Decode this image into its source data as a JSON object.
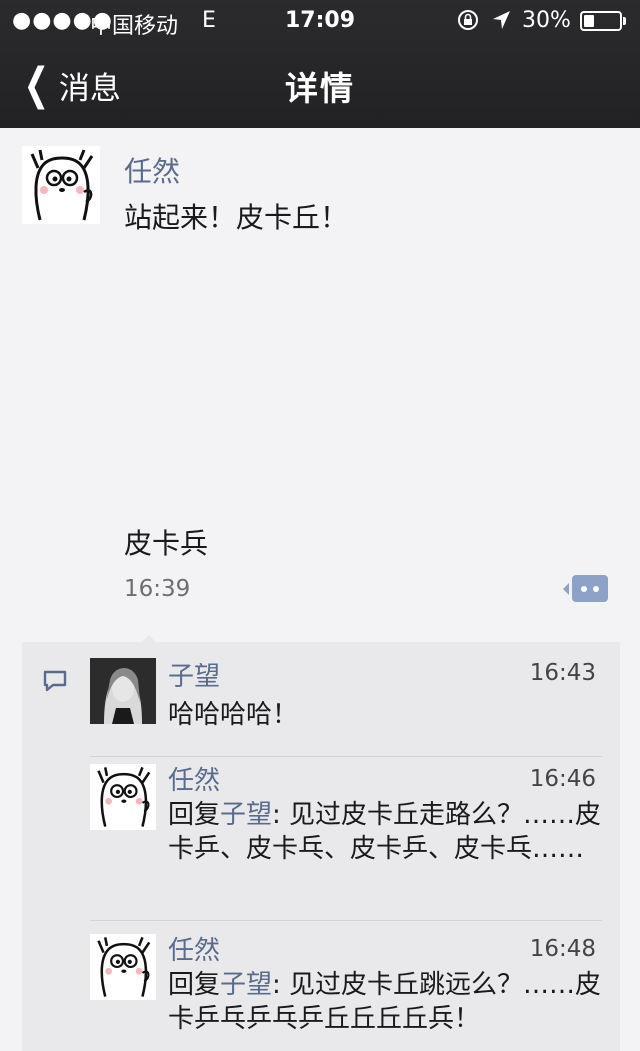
{
  "status_bar": {
    "signal": "●●●●●",
    "carrier": "中国移动",
    "network": "E",
    "time": "17:09",
    "battery_text": "30%",
    "battery_level": 0.3
  },
  "nav": {
    "back_label": "消息",
    "title": "详情"
  },
  "post": {
    "author": "任然",
    "text_line1": "站起来！皮卡丘！",
    "text_line2": "皮卡兵",
    "time": "16:39"
  },
  "comments": [
    {
      "author": "子望",
      "time": "16:43",
      "text": "哈哈哈哈！"
    },
    {
      "author": "任然",
      "time": "16:46",
      "reply_prefix": "回复",
      "reply_to": "子望",
      "text": ": 见过皮卡丘走路么？……皮卡乒、皮卡乓、皮卡乒、皮卡乓……"
    },
    {
      "author": "任然",
      "time": "16:48",
      "reply_prefix": "回复",
      "reply_to": "子望",
      "text": ": 见过皮卡丘跳远么？……皮卡乒乓乒乓乒丘丘丘丘兵！"
    }
  ],
  "colors": {
    "header_bg": "#232325",
    "name_blue": "#5a6b8c",
    "comment_button": "#8ea1c6",
    "comments_bg": "#e9e9ec"
  },
  "icons": {
    "back": "chevron-left-icon",
    "comment": "comment-icon",
    "comment_list": "speech-bubble-icon"
  }
}
